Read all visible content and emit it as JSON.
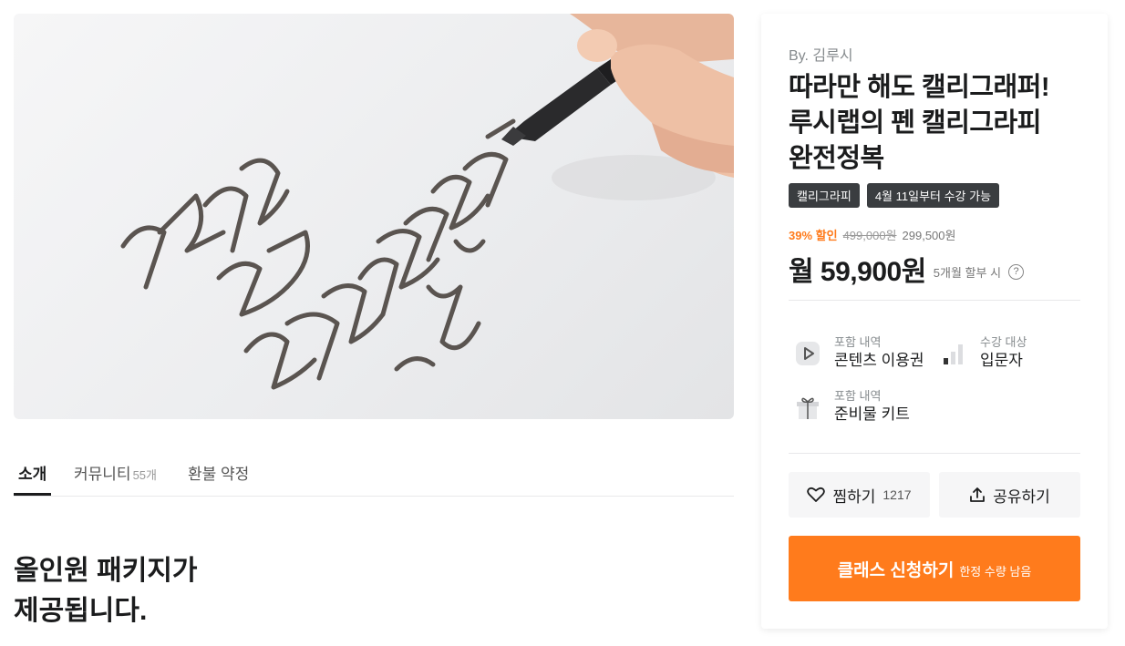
{
  "hero": {
    "image": "calligraphy-hand-writing-photo"
  },
  "tabs": [
    {
      "label": "소개",
      "count": ""
    },
    {
      "label": "커뮤니티",
      "count": "55개"
    },
    {
      "label": "환불 약정",
      "count": ""
    }
  ],
  "section": {
    "title_line1": "올인원 패키지가",
    "title_line2": "제공됩니다."
  },
  "product": {
    "author": "By. 김루시",
    "title_line1": "따라만 해도 캘리그래퍼!",
    "title_line2": "루시랩의 펜 캘리그라피",
    "title_line3": "완전정복",
    "badges": [
      "캘리그라피",
      "4월 11일부터 수강 가능"
    ],
    "discount": "39% 할인",
    "original_price": "499,000원",
    "sale_price": "299,500원",
    "monthly_price": "월 59,900원",
    "installment": "5개월 할부 시",
    "help_icon": "question-circle-icon",
    "info": [
      {
        "label": "포함 내역",
        "value": "콘텐츠 이용권",
        "icon": "play-icon"
      },
      {
        "label": "수강 대상",
        "value": "입문자",
        "icon": "level-bars-icon"
      },
      {
        "label": "포함 내역",
        "value": "준비물 키트",
        "icon": "gift-icon"
      }
    ],
    "wishlist_label": "찜하기",
    "wishlist_count": "1217",
    "share_label": "공유하기",
    "apply_label": "클래스 신청하기",
    "apply_sub": "한정 수량 남음"
  },
  "colors": {
    "accent": "#ff7b1c",
    "badge": "#3a3d40",
    "text": "#1b1c1d"
  }
}
